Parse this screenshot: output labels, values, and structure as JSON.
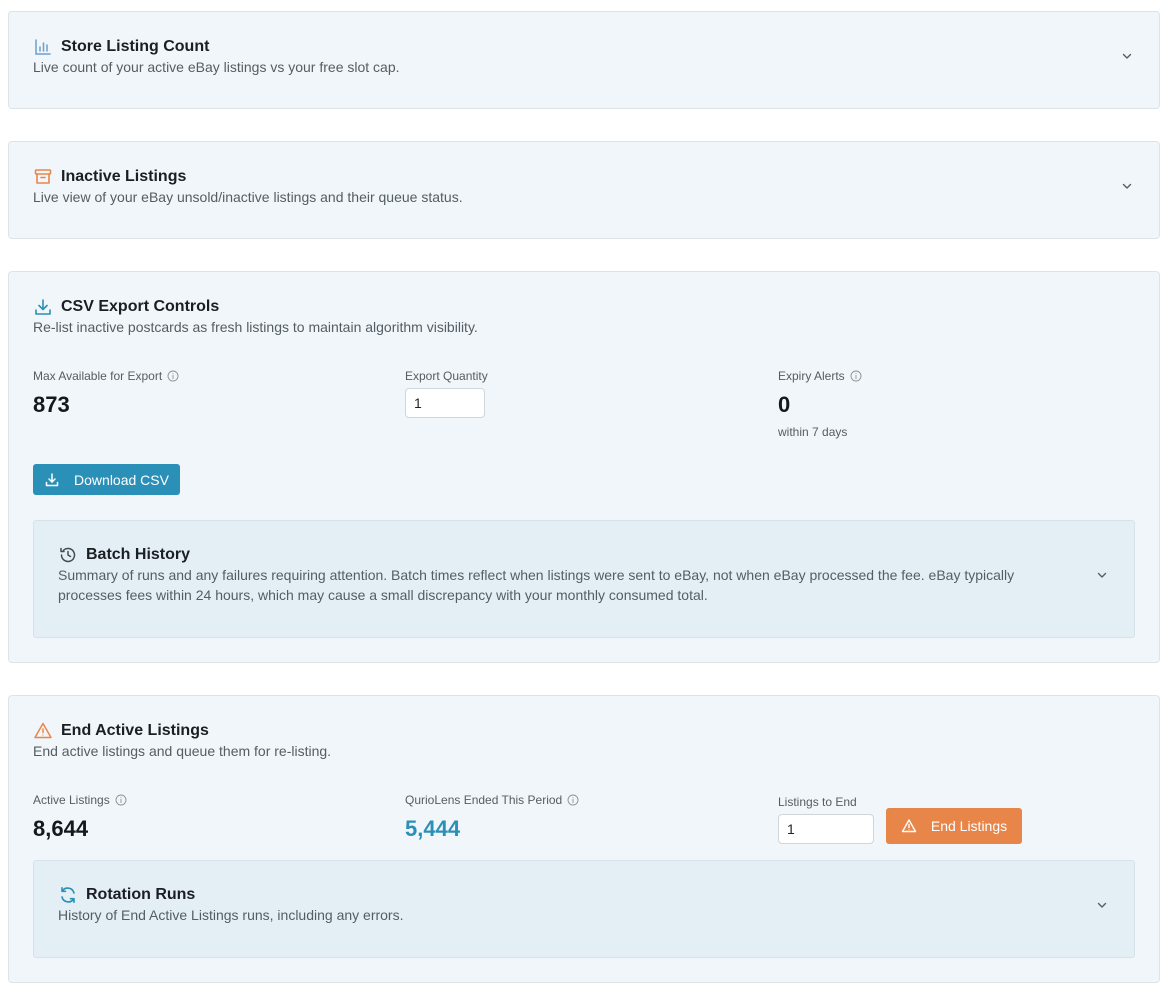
{
  "store_listing": {
    "title": "Store Listing Count",
    "description": "Live count of your active eBay listings vs your free slot cap."
  },
  "inactive_listings": {
    "title": "Inactive Listings",
    "description": "Live view of your eBay unsold/inactive listings and their queue status."
  },
  "csv_export": {
    "title": "CSV Export Controls",
    "description": "Re-list inactive postcards as fresh listings to maintain algorithm visibility.",
    "max_available_label": "Max Available for Export",
    "max_available_value": "873",
    "export_quantity_label": "Export Quantity",
    "export_quantity_value": "1",
    "expiry_alerts_label": "Expiry Alerts",
    "expiry_alerts_value": "0",
    "expiry_alerts_sub": "within 7 days",
    "download_label": "Download CSV",
    "batch_history": {
      "title": "Batch History",
      "description": "Summary of runs and any failures requiring attention. Batch times reflect when listings were sent to eBay, not when eBay processed the fee. eBay typically processes fees within 24 hours, which may cause a small discrepancy with your monthly consumed total."
    }
  },
  "end_active": {
    "title": "End Active Listings",
    "description": "End active listings and queue them for re-listing.",
    "active_listings_label": "Active Listings",
    "active_listings_value": "8,644",
    "ended_label": "QurioLens Ended This Period",
    "ended_value": "5,444",
    "listings_to_end_label": "Listings to End",
    "listings_to_end_value": "1",
    "end_button_label": "End Listings",
    "rotation_runs": {
      "title": "Rotation Runs",
      "description": "History of End Active Listings runs, including any errors."
    }
  },
  "colors": {
    "accent_blue": "#2b90b8",
    "accent_orange": "#e8864a",
    "card_bg": "#f0f6f9",
    "subcard_bg": "#e3eff5"
  }
}
